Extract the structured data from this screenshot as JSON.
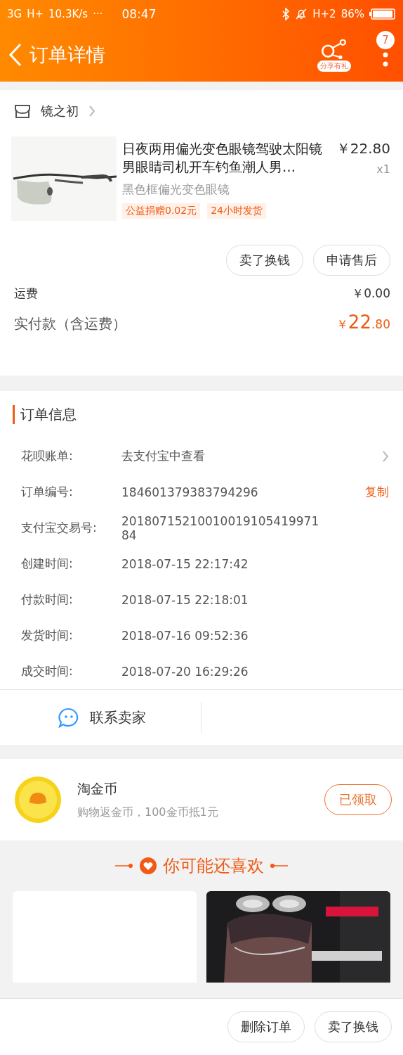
{
  "status_bar": {
    "left": [
      "3G",
      "H+",
      "10.3K/s"
    ],
    "dots": "···",
    "time": "08:47",
    "network": "H+2",
    "battery": "86%"
  },
  "header": {
    "title": "订单详情",
    "share_label": "分享有礼",
    "badge": "7"
  },
  "shop": {
    "name": "镜之初"
  },
  "item": {
    "title": "日夜两用偏光变色眼镜驾驶太阳镜男眼睛司机开车钓鱼潮人男…",
    "price": "￥22.80",
    "qty": "x1",
    "sku": "黑色框偏光变色眼镜",
    "tags": [
      "公益捐赠0.02元",
      "24小时发货"
    ],
    "buttons": [
      "卖了换钱",
      "申请售后"
    ]
  },
  "fees": {
    "shipping_label": "运费",
    "shipping": "￥0.00",
    "paid_label": "实付款（含运费）",
    "paid_currency": "￥",
    "paid_int": "22",
    "paid_dec": ".80"
  },
  "order_info": {
    "title": "订单信息",
    "rows": [
      {
        "label": "花呗账单:",
        "value": "去支付宝中查看",
        "kind": "link"
      },
      {
        "label": "订单编号:",
        "value": "184601379383794296",
        "kind": "copy",
        "action": "复制"
      },
      {
        "label": "支付宝交易号:",
        "value": "2018071521001001910541997184",
        "kind": "wrap"
      },
      {
        "label": "创建时间:",
        "value": "2018-07-15 22:17:42",
        "kind": "plain"
      },
      {
        "label": "付款时间:",
        "value": "2018-07-15 22:18:01",
        "kind": "plain"
      },
      {
        "label": "发货时间:",
        "value": "2018-07-16 09:52:36",
        "kind": "plain"
      },
      {
        "label": "成交时间:",
        "value": "2018-07-20 16:29:26",
        "kind": "plain"
      }
    ],
    "contact": "联系卖家"
  },
  "coins": {
    "title": "淘金币",
    "subtitle": "购物返金币，100金币抵1元",
    "button": "已领取"
  },
  "recommend": {
    "title": "你可能还喜欢"
  },
  "bottom_buttons": [
    "删除订单",
    "卖了换钱"
  ]
}
